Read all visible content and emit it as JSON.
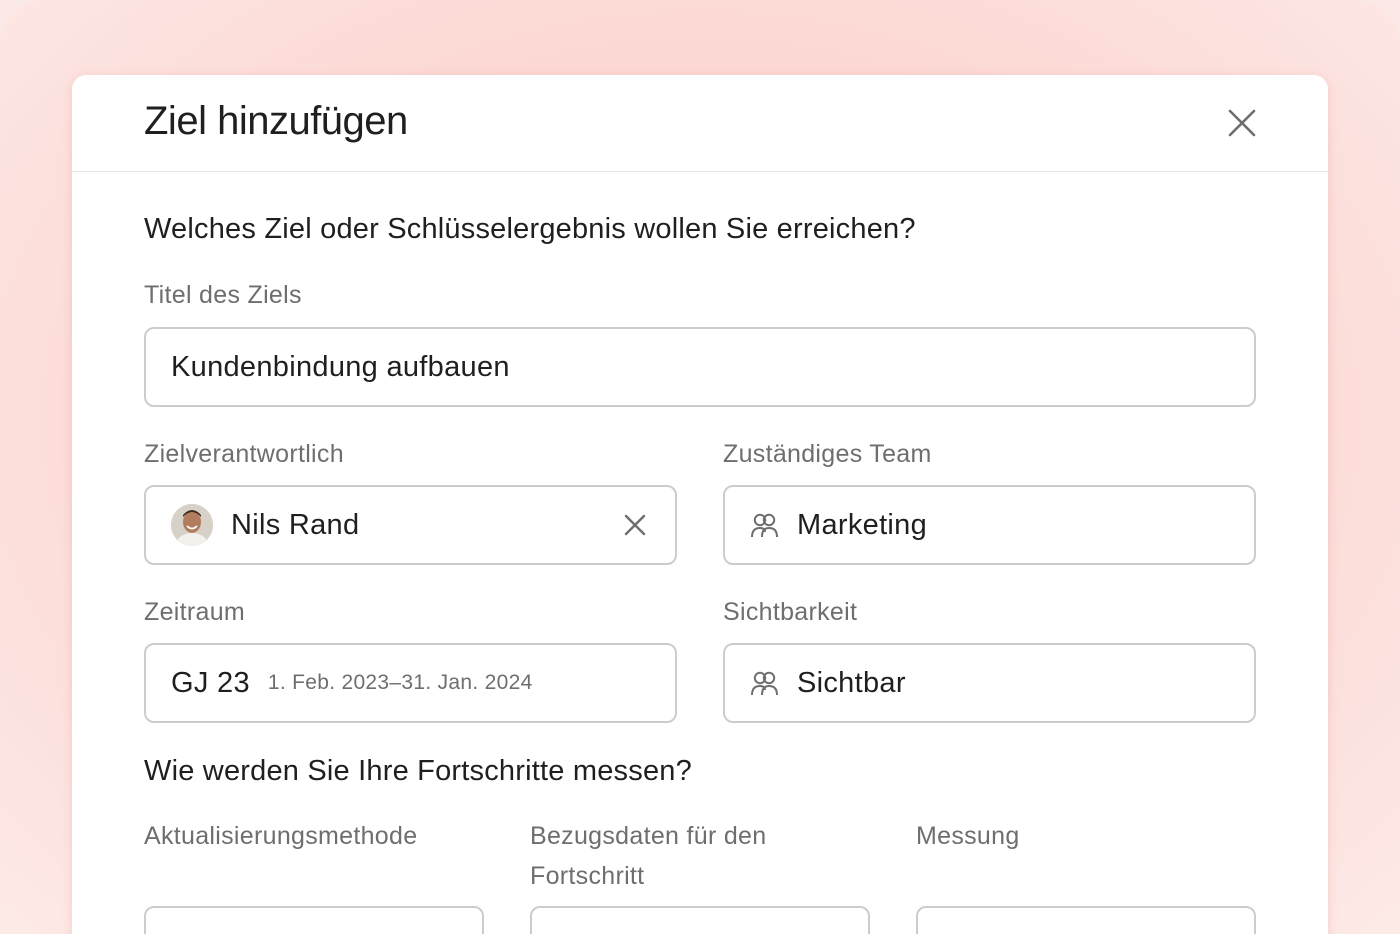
{
  "dialog": {
    "title": "Ziel hinzufügen",
    "question_goal": "Welches Ziel oder Schlüsselergebnis wollen Sie erreichen?",
    "question_progress": "Wie werden Sie Ihre Fortschritte messen?"
  },
  "form": {
    "goal_title": {
      "label": "Titel des Ziels",
      "value": "Kundenbindung aufbauen"
    },
    "owner": {
      "label": "Zielverantwortlich",
      "value": "Nils Rand"
    },
    "team": {
      "label": "Zuständiges Team",
      "value": "Marketing"
    },
    "period": {
      "label": "Zeitraum",
      "value": "GJ 23",
      "range": "1. Feb. 2023–31. Jan. 2024"
    },
    "visibility": {
      "label": "Sichtbarkeit",
      "value": "Sichtbar"
    },
    "update_method": {
      "label": "Aktualisierungsmethode"
    },
    "progress_source": {
      "label_line1": "Bezugsdaten für den",
      "label_line2": "Fortschritt"
    },
    "measurement": {
      "label": "Messung"
    }
  },
  "colors": {
    "background": "#fcd9d5",
    "text_primary": "#1e1f21",
    "text_secondary": "#6d6e6f",
    "border": "#cfcbcb"
  },
  "icons": {
    "close": "close-icon",
    "clear": "close-icon",
    "team": "team-icon",
    "visibility": "team-icon"
  }
}
